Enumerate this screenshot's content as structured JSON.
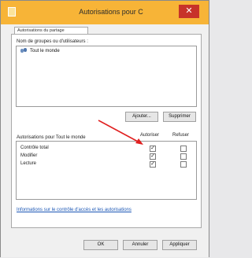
{
  "window": {
    "title": "Autorisations pour C"
  },
  "tab": {
    "label": "Autorisations du partage"
  },
  "groups": {
    "label": "Nom de groupes ou d'utilisateurs :",
    "items": [
      "Tout le monde"
    ]
  },
  "buttons": {
    "add": "Ajouter...",
    "remove": "Supprimer"
  },
  "permissions": {
    "label": "Autorisations pour Tout le monde",
    "col_allow": "Autoriser",
    "col_deny": "Refuser",
    "rows": [
      {
        "name": "Contrôle total",
        "allow": true,
        "deny": false
      },
      {
        "name": "Modifier",
        "allow": true,
        "deny": false
      },
      {
        "name": "Lecture",
        "allow": true,
        "deny": false
      }
    ]
  },
  "link": {
    "text": "Informations sur le contrôle d'accès et les autorisations"
  },
  "footer": {
    "ok": "OK",
    "cancel": "Annuler",
    "apply": "Appliquer"
  },
  "annotation": {
    "color": "#e02020"
  }
}
